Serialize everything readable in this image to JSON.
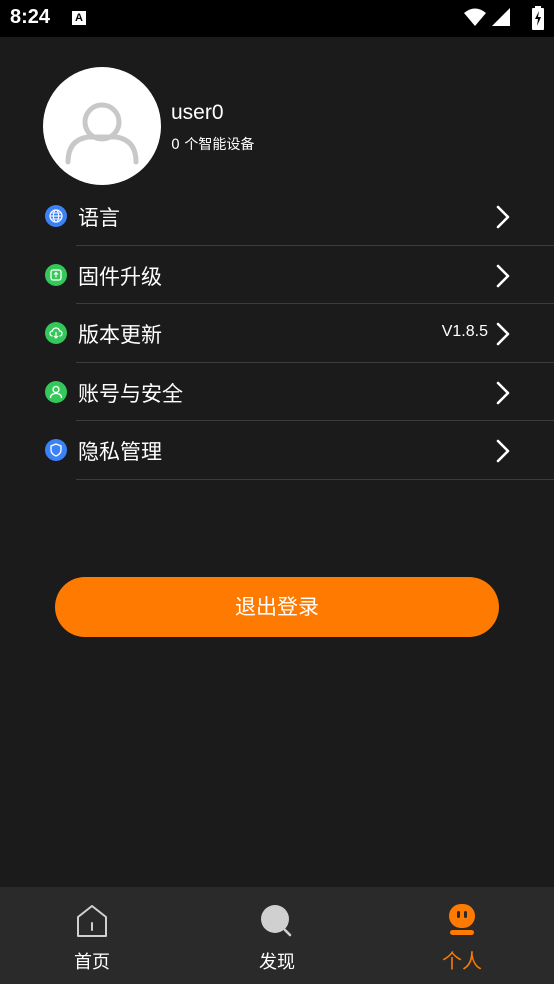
{
  "status_bar": {
    "time": "8:24",
    "notification_badge": "A"
  },
  "profile": {
    "username": "user0",
    "device_count": "0 个智能设备"
  },
  "menu": {
    "items": [
      {
        "label": "语言",
        "icon": "globe-icon",
        "icon_color": "#3b82f6",
        "value": ""
      },
      {
        "label": "固件升级",
        "icon": "chip-icon",
        "icon_color": "#34c759",
        "value": ""
      },
      {
        "label": "版本更新",
        "icon": "cloud-icon",
        "icon_color": "#34c759",
        "value": "V1.8.5"
      },
      {
        "label": "账号与安全",
        "icon": "person-icon",
        "icon_color": "#34c759",
        "value": ""
      },
      {
        "label": "隐私管理",
        "icon": "shield-icon",
        "icon_color": "#3b82f6",
        "value": ""
      }
    ]
  },
  "logout": {
    "label": "退出登录"
  },
  "tabs": [
    {
      "label": "首页",
      "icon": "home-icon",
      "active": false
    },
    {
      "label": "发现",
      "icon": "discover-icon",
      "active": false
    },
    {
      "label": "个人",
      "icon": "profile-icon",
      "active": true
    }
  ],
  "colors": {
    "accent": "#ff7a00",
    "background": "#1b1b1b",
    "tab_bar": "#2a2a2a"
  }
}
